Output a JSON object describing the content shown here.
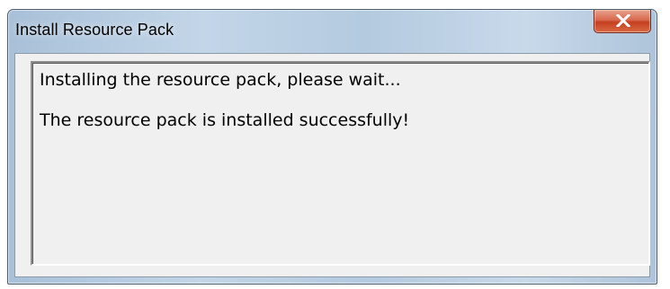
{
  "window": {
    "title": "Install Resource Pack"
  },
  "title_bar": {
    "close_icon": "close-x-icon"
  },
  "output": {
    "lines": [
      "Installing the resource pack, please wait...",
      "The resource pack is installed successfully!"
    ]
  },
  "colors": {
    "close_button": "#d0563a",
    "client_background": "#f0f0f0"
  }
}
